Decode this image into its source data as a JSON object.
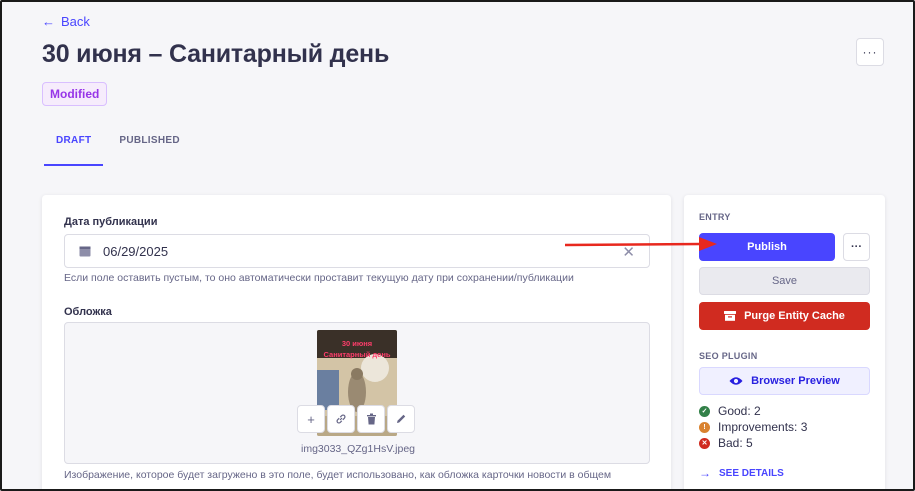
{
  "header": {
    "back_label": "Back",
    "title": "30 июня – Санитарный день",
    "more_label": "···",
    "status_badge": "Modified"
  },
  "tabs": [
    {
      "label": "DRAFT",
      "active": true
    },
    {
      "label": "PUBLISHED",
      "active": false
    }
  ],
  "form": {
    "date_field": {
      "label": "Дата публикации",
      "value": "06/29/2025",
      "hint": "Если поле оставить пустым, то оно автоматически проставит текущую дату при сохранении/публикации",
      "clear_icon": "close-icon"
    },
    "cover_field": {
      "label": "Обложка",
      "filename": "img3033_QZg1HsV.jpeg",
      "thumbnail_caption": "30 июня Санитарный день",
      "actions": [
        "add-icon",
        "link-icon",
        "trash-icon",
        "pencil-icon"
      ],
      "hint": "Изображение, которое будет загружено в это поле, будет использовано, как обложка карточки новости в общем"
    }
  },
  "sidebar": {
    "entry_label": "ENTRY",
    "publish_label": "Publish",
    "more_label": "···",
    "save_label": "Save",
    "purge_label": "Purge Entity Cache",
    "seo_label": "SEO PLUGIN",
    "preview_label": "Browser Preview",
    "seo_results": [
      {
        "label": "Good: 2",
        "color": "#328048",
        "icon": "check-icon"
      },
      {
        "label": "Improvements: 3",
        "color": "#d9822f",
        "icon": "exclamation-icon"
      },
      {
        "label": "Bad: 5",
        "color": "#d02b20",
        "icon": "cross-icon"
      }
    ],
    "see_details_label": "SEE DETAILS"
  },
  "colors": {
    "primary": "#4945ff",
    "danger": "#d02b20",
    "annotation_arrow": "#e8281e"
  }
}
